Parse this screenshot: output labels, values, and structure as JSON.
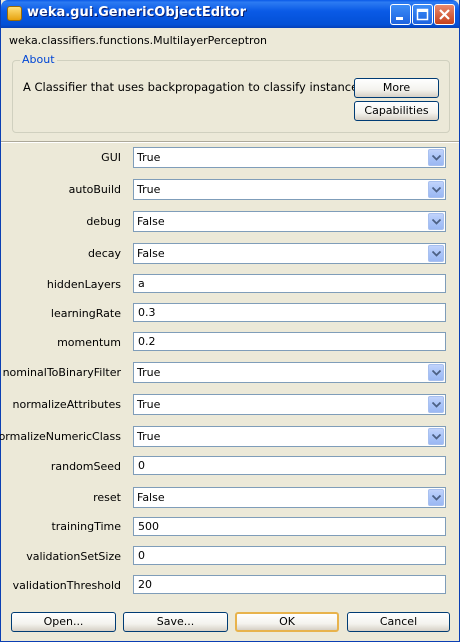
{
  "window": {
    "title": "weka.gui.GenericObjectEditor"
  },
  "classifier": {
    "name": "weka.classifiers.functions.MultilayerPerceptron"
  },
  "about": {
    "legend": "About",
    "description": "A Classifier that uses backpropagation to classify instances.",
    "more_label": "More",
    "capabilities_label": "Capabilities"
  },
  "properties": [
    {
      "label": "GUI",
      "type": "combo",
      "value": "True"
    },
    {
      "label": "autoBuild",
      "type": "combo",
      "value": "True"
    },
    {
      "label": "debug",
      "type": "combo",
      "value": "False"
    },
    {
      "label": "decay",
      "type": "combo",
      "value": "False"
    },
    {
      "label": "hiddenLayers",
      "type": "text",
      "value": "a"
    },
    {
      "label": "learningRate",
      "type": "text",
      "value": "0.3"
    },
    {
      "label": "momentum",
      "type": "text",
      "value": "0.2"
    },
    {
      "label": "nominalToBinaryFilter",
      "type": "combo",
      "value": "True"
    },
    {
      "label": "normalizeAttributes",
      "type": "combo",
      "value": "True"
    },
    {
      "label": "normalizeNumericClass",
      "type": "combo",
      "value": "True"
    },
    {
      "label": "randomSeed",
      "type": "text",
      "value": "0"
    },
    {
      "label": "reset",
      "type": "combo",
      "value": "False"
    },
    {
      "label": "trainingTime",
      "type": "text",
      "value": "500"
    },
    {
      "label": "validationSetSize",
      "type": "text",
      "value": "0"
    },
    {
      "label": "validationThreshold",
      "type": "text",
      "value": "20"
    }
  ],
  "buttons": {
    "open": "Open...",
    "save": "Save...",
    "ok": "OK",
    "cancel": "Cancel"
  },
  "colors": {
    "titlebar": "#0a5ae6",
    "accent_link": "#0046d5",
    "background": "#ece9d8"
  }
}
